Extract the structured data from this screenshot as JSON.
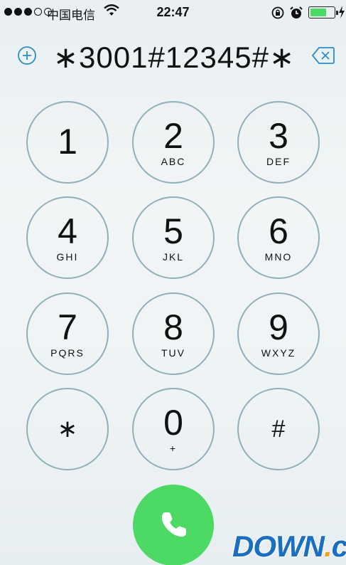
{
  "status_bar": {
    "carrier": "中国电信",
    "time": "22:47",
    "battery_level": 0.7,
    "signal_bars": 3,
    "signal_total": 5
  },
  "dialer": {
    "number": "∗3001#12345#∗",
    "keys": [
      {
        "digit": "1",
        "letters": ""
      },
      {
        "digit": "2",
        "letters": "ABC"
      },
      {
        "digit": "3",
        "letters": "DEF"
      },
      {
        "digit": "4",
        "letters": "GHI"
      },
      {
        "digit": "5",
        "letters": "JKL"
      },
      {
        "digit": "6",
        "letters": "MNO"
      },
      {
        "digit": "7",
        "letters": "PQRS"
      },
      {
        "digit": "8",
        "letters": "TUV"
      },
      {
        "digit": "9",
        "letters": "WXYZ"
      },
      {
        "digit": "∗",
        "letters": ""
      },
      {
        "digit": "0",
        "letters": "+"
      },
      {
        "digit": "#",
        "letters": ""
      }
    ]
  },
  "watermark": {
    "main": "DOWN",
    "dot": ".",
    "tld": "cc"
  },
  "colors": {
    "call_green": "#4cd964",
    "key_ring": "#8fb0bb",
    "accent_blue": "#2a8ec9"
  },
  "icons": {
    "add": "plus-circle-icon",
    "delete": "backspace-icon",
    "call": "phone-icon"
  }
}
